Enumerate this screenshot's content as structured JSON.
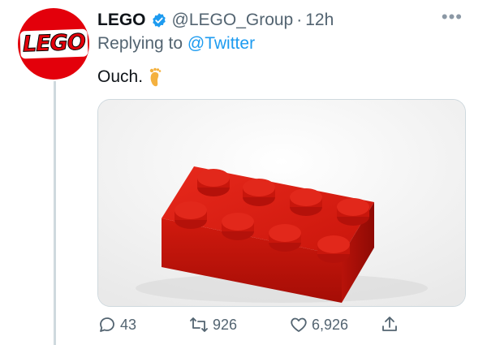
{
  "tweet": {
    "author_name": "LEGO",
    "handle": "@LEGO_Group",
    "separator": "·",
    "time": "12h",
    "reply_prefix": "Replying to",
    "reply_to": "@Twitter",
    "text": "Ouch.",
    "emoji_icon": "foot-icon",
    "avatar_logo_text": "LEGO",
    "media_icon": "red-lego-brick-image"
  },
  "actions": {
    "reply_count": "43",
    "retweet_count": "926",
    "like_count": "6,926"
  },
  "colors": {
    "brand_red": "#e3000b",
    "link_blue": "#1d9bf0",
    "secondary_text": "#536471"
  }
}
